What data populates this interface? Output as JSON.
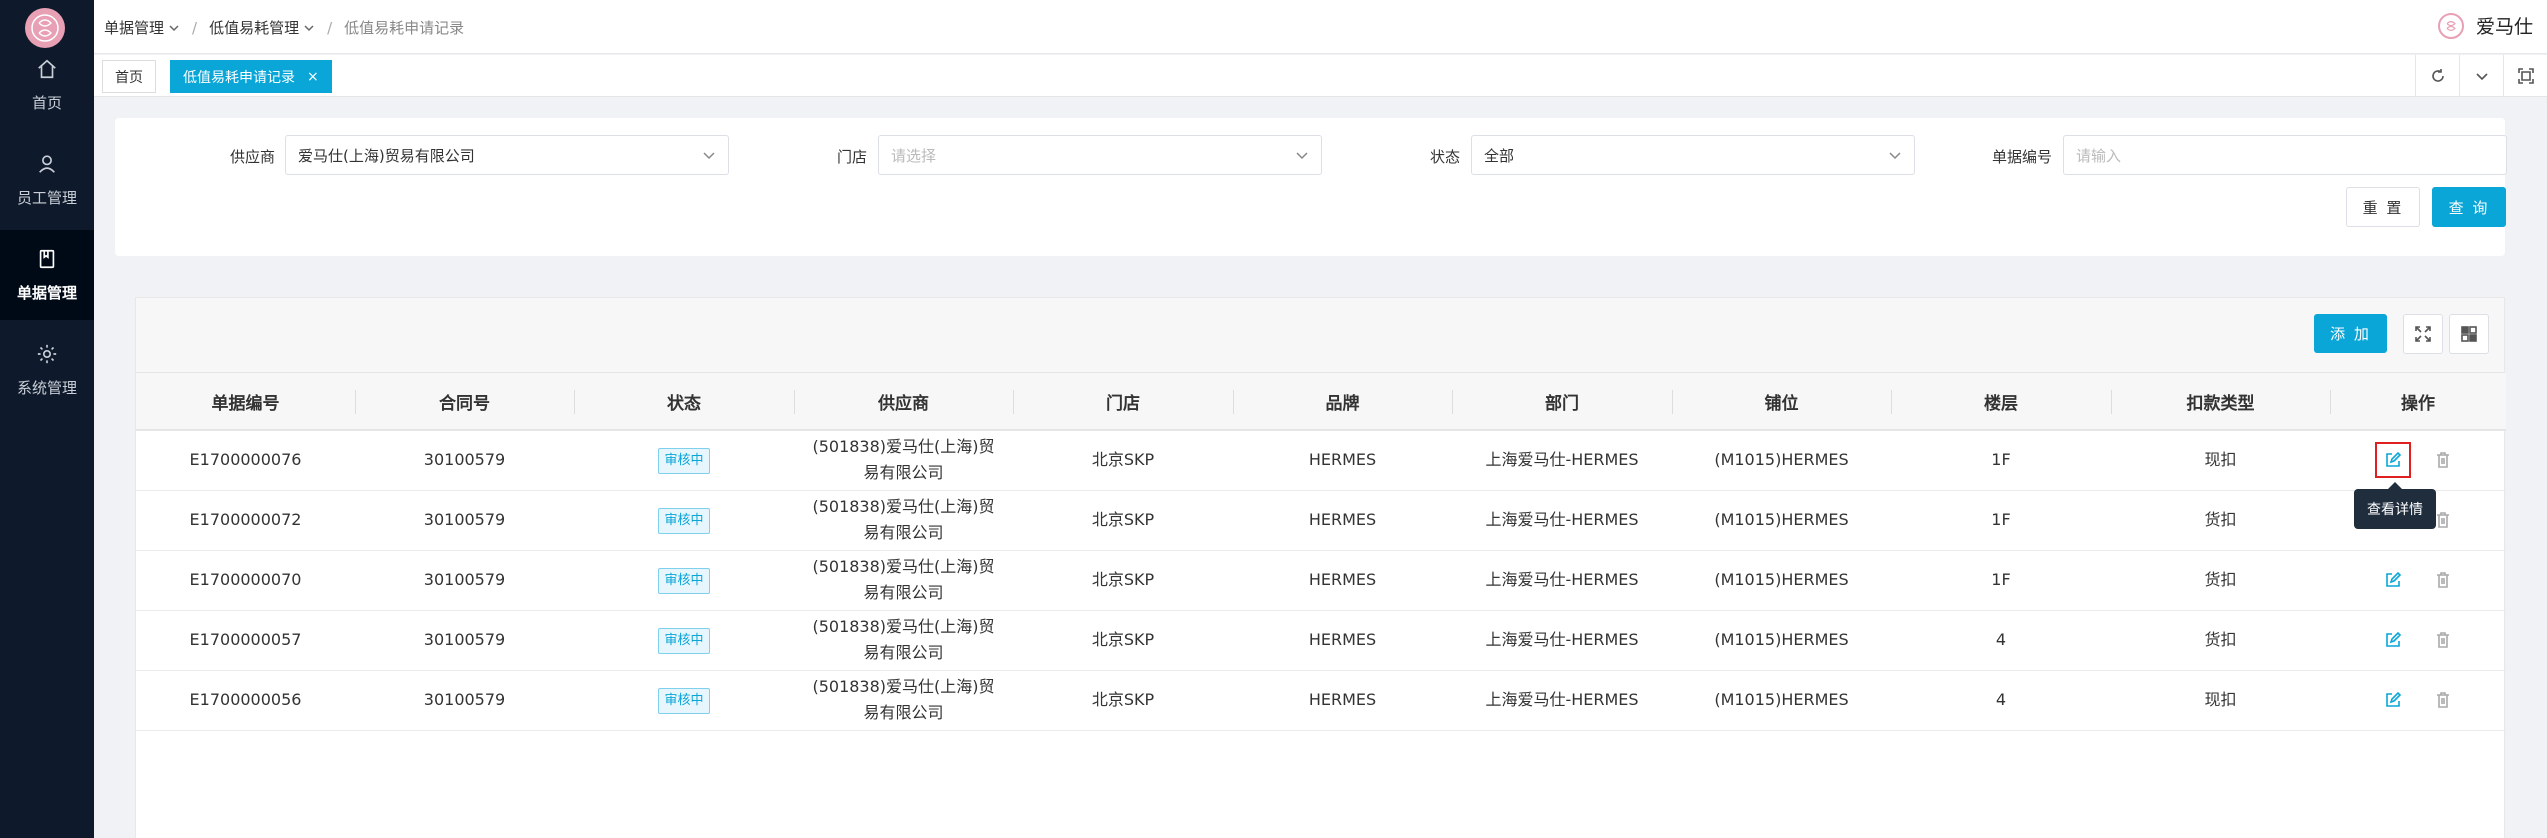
{
  "sidebar": {
    "items": [
      {
        "label": "首页",
        "icon": "home-icon"
      },
      {
        "label": "员工管理",
        "icon": "user-icon"
      },
      {
        "label": "单据管理",
        "icon": "document-icon",
        "active": true
      },
      {
        "label": "系统管理",
        "icon": "gear-icon"
      }
    ]
  },
  "header": {
    "breadcrumb": [
      "单据管理",
      "低值易耗管理",
      "低值易耗申请记录"
    ],
    "user_name": "爱马仕"
  },
  "tabs": [
    {
      "label": "首页"
    },
    {
      "label": "低值易耗申请记录",
      "active": true,
      "close": "×"
    }
  ],
  "filters": {
    "supplier": {
      "label": "供应商",
      "value": "爱马仕(上海)贸易有限公司"
    },
    "store": {
      "label": "门店",
      "placeholder": "请选择"
    },
    "status": {
      "label": "状态",
      "value": "全部"
    },
    "doc_no": {
      "label": "单据编号",
      "placeholder": "请输入"
    },
    "reset_label": "重 置",
    "search_label": "查 询"
  },
  "table": {
    "add_label": "添 加",
    "columns": [
      "单据编号",
      "合同号",
      "状态",
      "供应商",
      "门店",
      "品牌",
      "部门",
      "铺位",
      "楼层",
      "扣款类型",
      "操作"
    ],
    "rows": [
      {
        "doc_no": "E1700000076",
        "contract": "30100579",
        "status": "审核中",
        "supplier_l1": "(501838)爱马仕(上海)贸",
        "supplier_l2": "易有限公司",
        "store": "北京SKP",
        "brand": "HERMES",
        "dept": "上海爱马仕-HERMES",
        "booth": "(M1015)HERMES",
        "floor": "1F",
        "deduct": "现扣"
      },
      {
        "doc_no": "E1700000072",
        "contract": "30100579",
        "status": "审核中",
        "supplier_l1": "(501838)爱马仕(上海)贸",
        "supplier_l2": "易有限公司",
        "store": "北京SKP",
        "brand": "HERMES",
        "dept": "上海爱马仕-HERMES",
        "booth": "(M1015)HERMES",
        "floor": "1F",
        "deduct": "货扣"
      },
      {
        "doc_no": "E1700000070",
        "contract": "30100579",
        "status": "审核中",
        "supplier_l1": "(501838)爱马仕(上海)贸",
        "supplier_l2": "易有限公司",
        "store": "北京SKP",
        "brand": "HERMES",
        "dept": "上海爱马仕-HERMES",
        "booth": "(M1015)HERMES",
        "floor": "1F",
        "deduct": "货扣"
      },
      {
        "doc_no": "E1700000057",
        "contract": "30100579",
        "status": "审核中",
        "supplier_l1": "(501838)爱马仕(上海)贸",
        "supplier_l2": "易有限公司",
        "store": "北京SKP",
        "brand": "HERMES",
        "dept": "上海爱马仕-HERMES",
        "booth": "(M1015)HERMES",
        "floor": "4",
        "deduct": "货扣"
      },
      {
        "doc_no": "E1700000056",
        "contract": "30100579",
        "status": "审核中",
        "supplier_l1": "(501838)爱马仕(上海)贸",
        "supplier_l2": "易有限公司",
        "store": "北京SKP",
        "brand": "HERMES",
        "dept": "上海爱马仕-HERMES",
        "booth": "(M1015)HERMES",
        "floor": "4",
        "deduct": "现扣"
      }
    ]
  },
  "tooltip": {
    "text": "查看详情"
  },
  "colors": {
    "primary": "#0aa6d8",
    "sidebar_bg": "#0e1a2b",
    "highlight": "#e02020"
  }
}
